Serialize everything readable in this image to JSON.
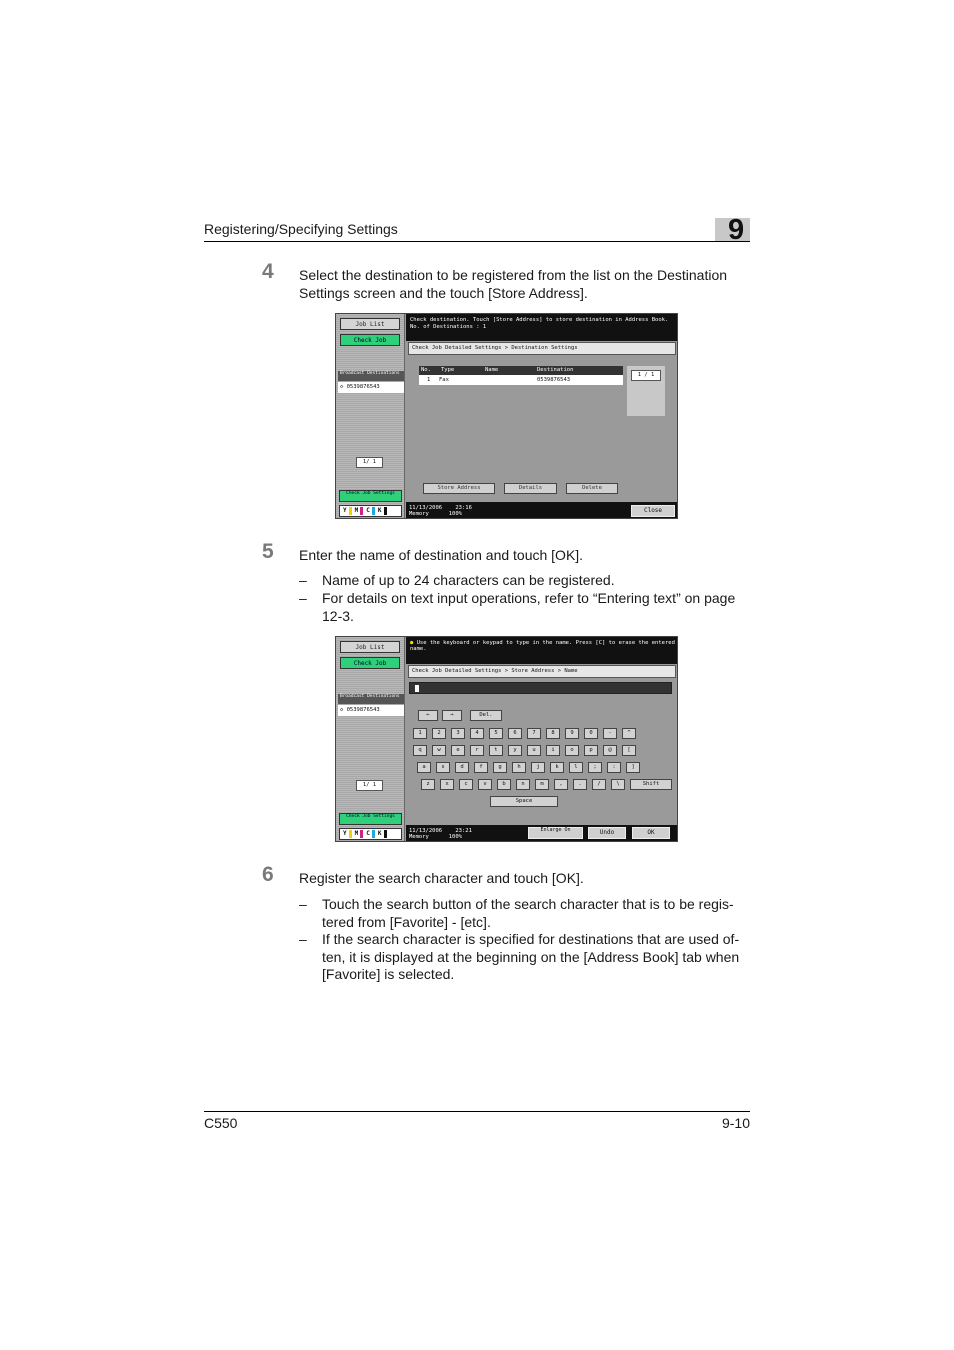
{
  "header": {
    "title": "Registering/Specifying Settings",
    "chapter": "9"
  },
  "steps": [
    {
      "number": "4",
      "text": "Select the destination to be registered from the list on the Destination Settings screen and the touch [Store Address]."
    },
    {
      "number": "5",
      "text": "Enter the name of destination and touch [OK].",
      "bullets": [
        "Name of up to 24 characters can be registered.",
        "For details on text input operations, refer to “Entering text” on page 12-3."
      ]
    },
    {
      "number": "6",
      "text": "Register the search character and touch [OK].",
      "bullets": [
        "Touch the search button of the search character that is to be regis-tered from [Favorite] - [etc].",
        "If the search character is specified for destinations that are used of-ten, it is displayed at the beginning on the [Address Book] tab when [Favorite] is selected."
      ]
    }
  ],
  "bullet_dash": "–",
  "sidebar": {
    "job_list": "Job List",
    "check_job": "Check Job",
    "destinations_header": "Broadcast Destinations",
    "destination_number": "0539876543",
    "page": "1/ 1",
    "check_job_settings": "Check Job Settings",
    "toner_letters": [
      "Y",
      "M",
      "C",
      "K"
    ]
  },
  "screen1": {
    "message": "Check destination. Touch [Store Address] to store destination in Address Book.",
    "count_label": "No. of Destinations",
    "count_value": ": 1",
    "breadcrumb": "Check Job Detailed Settings > Destination Settings",
    "table": {
      "headers": [
        "No.",
        "Type",
        "Name",
        "Destination"
      ],
      "rows": [
        {
          "no": "1",
          "type": "Fax",
          "name": "",
          "destination": "0539876543"
        }
      ]
    },
    "page": "1 / 1",
    "buttons": {
      "store_address": "Store Address",
      "details": "Details",
      "delete": "Delete",
      "close": "Close"
    },
    "status": {
      "date": "11/13/2006",
      "time": "23:16",
      "memory_label": "Memory",
      "memory_value": "100%"
    }
  },
  "screen2": {
    "message": "Use the keyboard or keypad to type in the name. Press [C] to erase the entered name.",
    "breadcrumb": "Check Job Detailed Settings > Store Address > Name",
    "keys": {
      "left": "←",
      "right": "→",
      "delete": "Del.",
      "row1": [
        "1",
        "2",
        "3",
        "4",
        "5",
        "6",
        "7",
        "8",
        "9",
        "0",
        "-",
        "^"
      ],
      "row2": [
        "q",
        "w",
        "e",
        "r",
        "t",
        "y",
        "u",
        "i",
        "o",
        "p",
        "@",
        "["
      ],
      "row3": [
        "a",
        "s",
        "d",
        "f",
        "g",
        "h",
        "j",
        "k",
        "l",
        ";",
        ":",
        "]"
      ],
      "row4": [
        "z",
        "x",
        "c",
        "v",
        "b",
        "n",
        "m",
        ",",
        ".",
        "/",
        "\\"
      ],
      "shift": "Shift",
      "space": "Space"
    },
    "buttons": {
      "enlarge": "Enlarge On",
      "undo": "Undo",
      "ok": "OK"
    },
    "status": {
      "date": "11/13/2006",
      "time": "23:21",
      "memory_label": "Memory",
      "memory_value": "100%"
    }
  },
  "footer": {
    "model": "C550",
    "page": "9-10"
  }
}
